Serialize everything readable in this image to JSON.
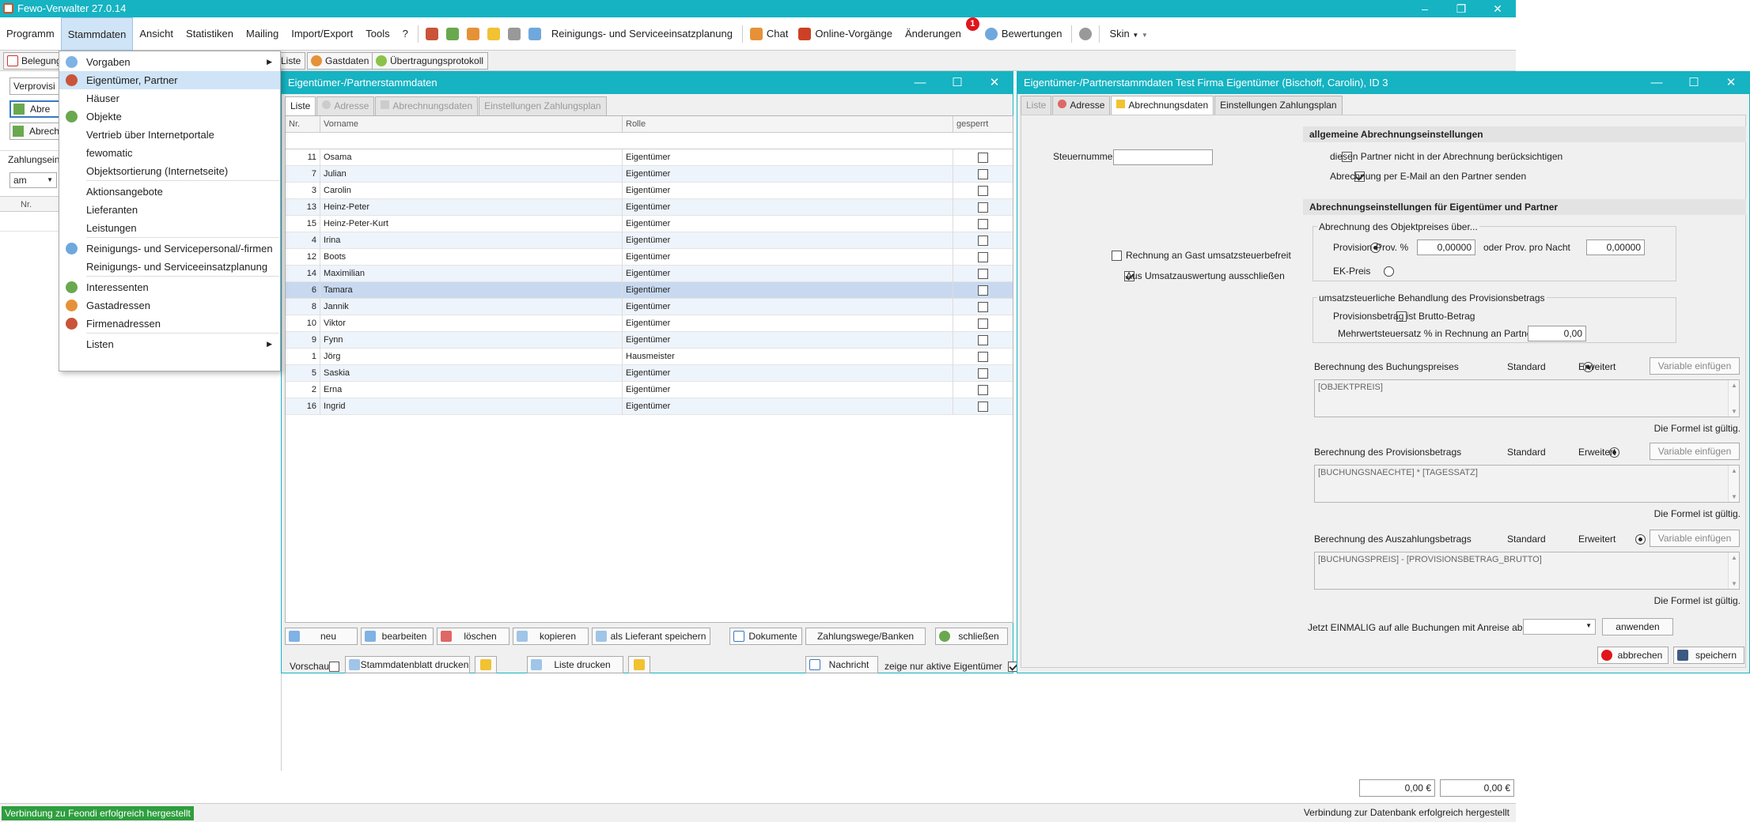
{
  "app": {
    "title": "Fewo-Verwalter 27.0.14",
    "minimize": "–",
    "maximize": "❐",
    "close": "✕"
  },
  "menubar": {
    "items": [
      "Programm",
      "Stammdaten",
      "Ansicht",
      "Statistiken",
      "Mailing",
      "Import/Export",
      "Tools",
      "?"
    ],
    "toolbar": {
      "einsatz": "Reinigungs- und Serviceeinsatzplanung",
      "chat": "Chat",
      "online": "Online-Vorgänge",
      "aenderungen": "Änderungen",
      "badge": "1",
      "bewertungen": "Bewertungen",
      "skin": "Skin"
    }
  },
  "tabstrip": {
    "belegung": "Belegung",
    "liste": "-Liste",
    "gastdaten": "Gastdaten",
    "protokoll": "Übertragungsprotokoll"
  },
  "leftpanel": {
    "combo1": "Verprovisi",
    "btn1": "Abre",
    "btn2": "Abrech",
    "label": "Zahlungsein-",
    "combo2": "am",
    "col_nr": "Nr."
  },
  "dropdown": {
    "items": [
      "Vorgaben",
      "Eigentümer, Partner",
      "Häuser",
      "Objekte",
      "Vertrieb über Internetportale",
      "fewomatic",
      "Objektsortierung (Internetseite)",
      "Aktionsangebote",
      "Lieferanten",
      "Leistungen",
      "Reinigungs- und Servicepersonal/-firmen",
      "Reinigungs- und Serviceeinsatzplanung",
      "Interessenten",
      "Gastadressen",
      "Firmenadressen",
      "Listen"
    ]
  },
  "owners": {
    "title": "Eigentümer-/Partnerstammdaten",
    "tabs": [
      "Liste",
      "Adresse",
      "Abrechnungsdaten",
      "Einstellungen Zahlungsplan"
    ],
    "columns": [
      "Nr.",
      "Vorname",
      "Rolle",
      "gesperrt"
    ],
    "rows": [
      {
        "nr": "11",
        "name": "Osama",
        "rolle": "Eigentümer"
      },
      {
        "nr": "7",
        "name": "Julian",
        "rolle": "Eigentümer"
      },
      {
        "nr": "3",
        "name": "Carolin",
        "rolle": "Eigentümer"
      },
      {
        "nr": "13",
        "name": "Heinz-Peter",
        "rolle": "Eigentümer"
      },
      {
        "nr": "15",
        "name": "Heinz-Peter-Kurt",
        "rolle": "Eigentümer"
      },
      {
        "nr": "4",
        "name": "Irina",
        "rolle": "Eigentümer"
      },
      {
        "nr": "12",
        "name": "Boots",
        "rolle": "Eigentümer"
      },
      {
        "nr": "14",
        "name": "Maximilian",
        "rolle": "Eigentümer"
      },
      {
        "nr": "6",
        "name": "Tamara",
        "rolle": "Eigentümer"
      },
      {
        "nr": "8",
        "name": "Jannik",
        "rolle": "Eigentümer"
      },
      {
        "nr": "10",
        "name": "Viktor",
        "rolle": "Eigentümer"
      },
      {
        "nr": "9",
        "name": "Fynn",
        "rolle": "Eigentümer"
      },
      {
        "nr": "1",
        "name": "Jörg",
        "rolle": "Hausmeister"
      },
      {
        "nr": "5",
        "name": "Saskia",
        "rolle": "Eigentümer"
      },
      {
        "nr": "2",
        "name": "Erna",
        "rolle": "Eigentümer"
      },
      {
        "nr": "16",
        "name": "Ingrid",
        "rolle": "Eigentümer"
      }
    ],
    "buttons": {
      "neu": "neu",
      "bearbeiten": "bearbeiten",
      "loeschen": "löschen",
      "kopieren": "kopieren",
      "lieferant": "als Lieferant speichern",
      "dokumente": "Dokumente",
      "zahlungswege": "Zahlungswege/Banken",
      "schliessen": "schließen",
      "vorschau": "Vorschau",
      "stammdatenblatt": "Stammdatenblatt drucken",
      "liste_drucken": "Liste drucken",
      "nachricht": "Nachricht",
      "aktive": "zeige nur aktive Eigentümer"
    }
  },
  "detail": {
    "title": "Eigentümer-/Partnerstammdaten Test Firma Eigentümer (Bischoff, Carolin), ID 3",
    "tabs": [
      "Liste",
      "Adresse",
      "Abrechnungsdaten",
      "Einstellungen Zahlungsplan"
    ],
    "steuernummer_label": "Steuernummer",
    "steuernummer": "",
    "rechnung_gast": "Rechnung an Gast umsatzsteuerbefreit",
    "umsatzauswertung": "Aus Umsatzauswertung ausschließen",
    "sec1": "allgemeine Abrechnungseinstellungen",
    "nicht_beruecksichtigen": "diesen Partner nicht in der Abrechnung berücksichtigen",
    "per_email": "Abrechnung per E-Mail an den Partner senden",
    "sec2": "Abrechnungseinstellungen für Eigentümer und Partner",
    "grp1": "Abrechnung des Objektpreises über...",
    "provision": "Provision",
    "prov_pct_label": "Prov. %",
    "prov_pct": "0,00000",
    "prov_nacht_label": "oder Prov. pro Nacht",
    "prov_nacht": "0,00000",
    "ekpreis": "EK-Preis",
    "grp2": "umsatzsteuerliche Behandlung des Provisionsbetrags",
    "brutto": "Provisionsbetrag ist Brutto-Betrag",
    "mwst_label": "Mehrwertsteuersatz % in Rechnung an Partner",
    "mwst": "0,00",
    "f1_label": "Berechnung des Buchungspreises",
    "f1": "[OBJEKTPREIS]",
    "f2_label": "Berechnung des Provisionsbetrags",
    "f2": "[BUCHUNGSNAECHTE] * [TAGESSATZ]",
    "f3_label": "Berechnung des Auszahlungsbetrags",
    "f3": "[BUCHUNGSPREIS] - [PROVISIONSBETRAG_BRUTTO]",
    "standard": "Standard",
    "erweitert": "Erweitert",
    "variable": "Variable einfügen",
    "gueltig": "Die Formel ist gültig.",
    "einmalig": "Jetzt EINMALIG auf alle Buchungen mit Anreise ab dem",
    "anwenden": "anwenden",
    "abbrechen": "abbrechen",
    "speichern": "speichern"
  },
  "bottom": {
    "sum1": "0,00 €",
    "sum2": "0,00 €"
  },
  "status": {
    "left": "Verbindung zu Feondi erfolgreich hergestellt",
    "right": "Verbindung zur Datenbank erfolgreich hergestellt"
  }
}
